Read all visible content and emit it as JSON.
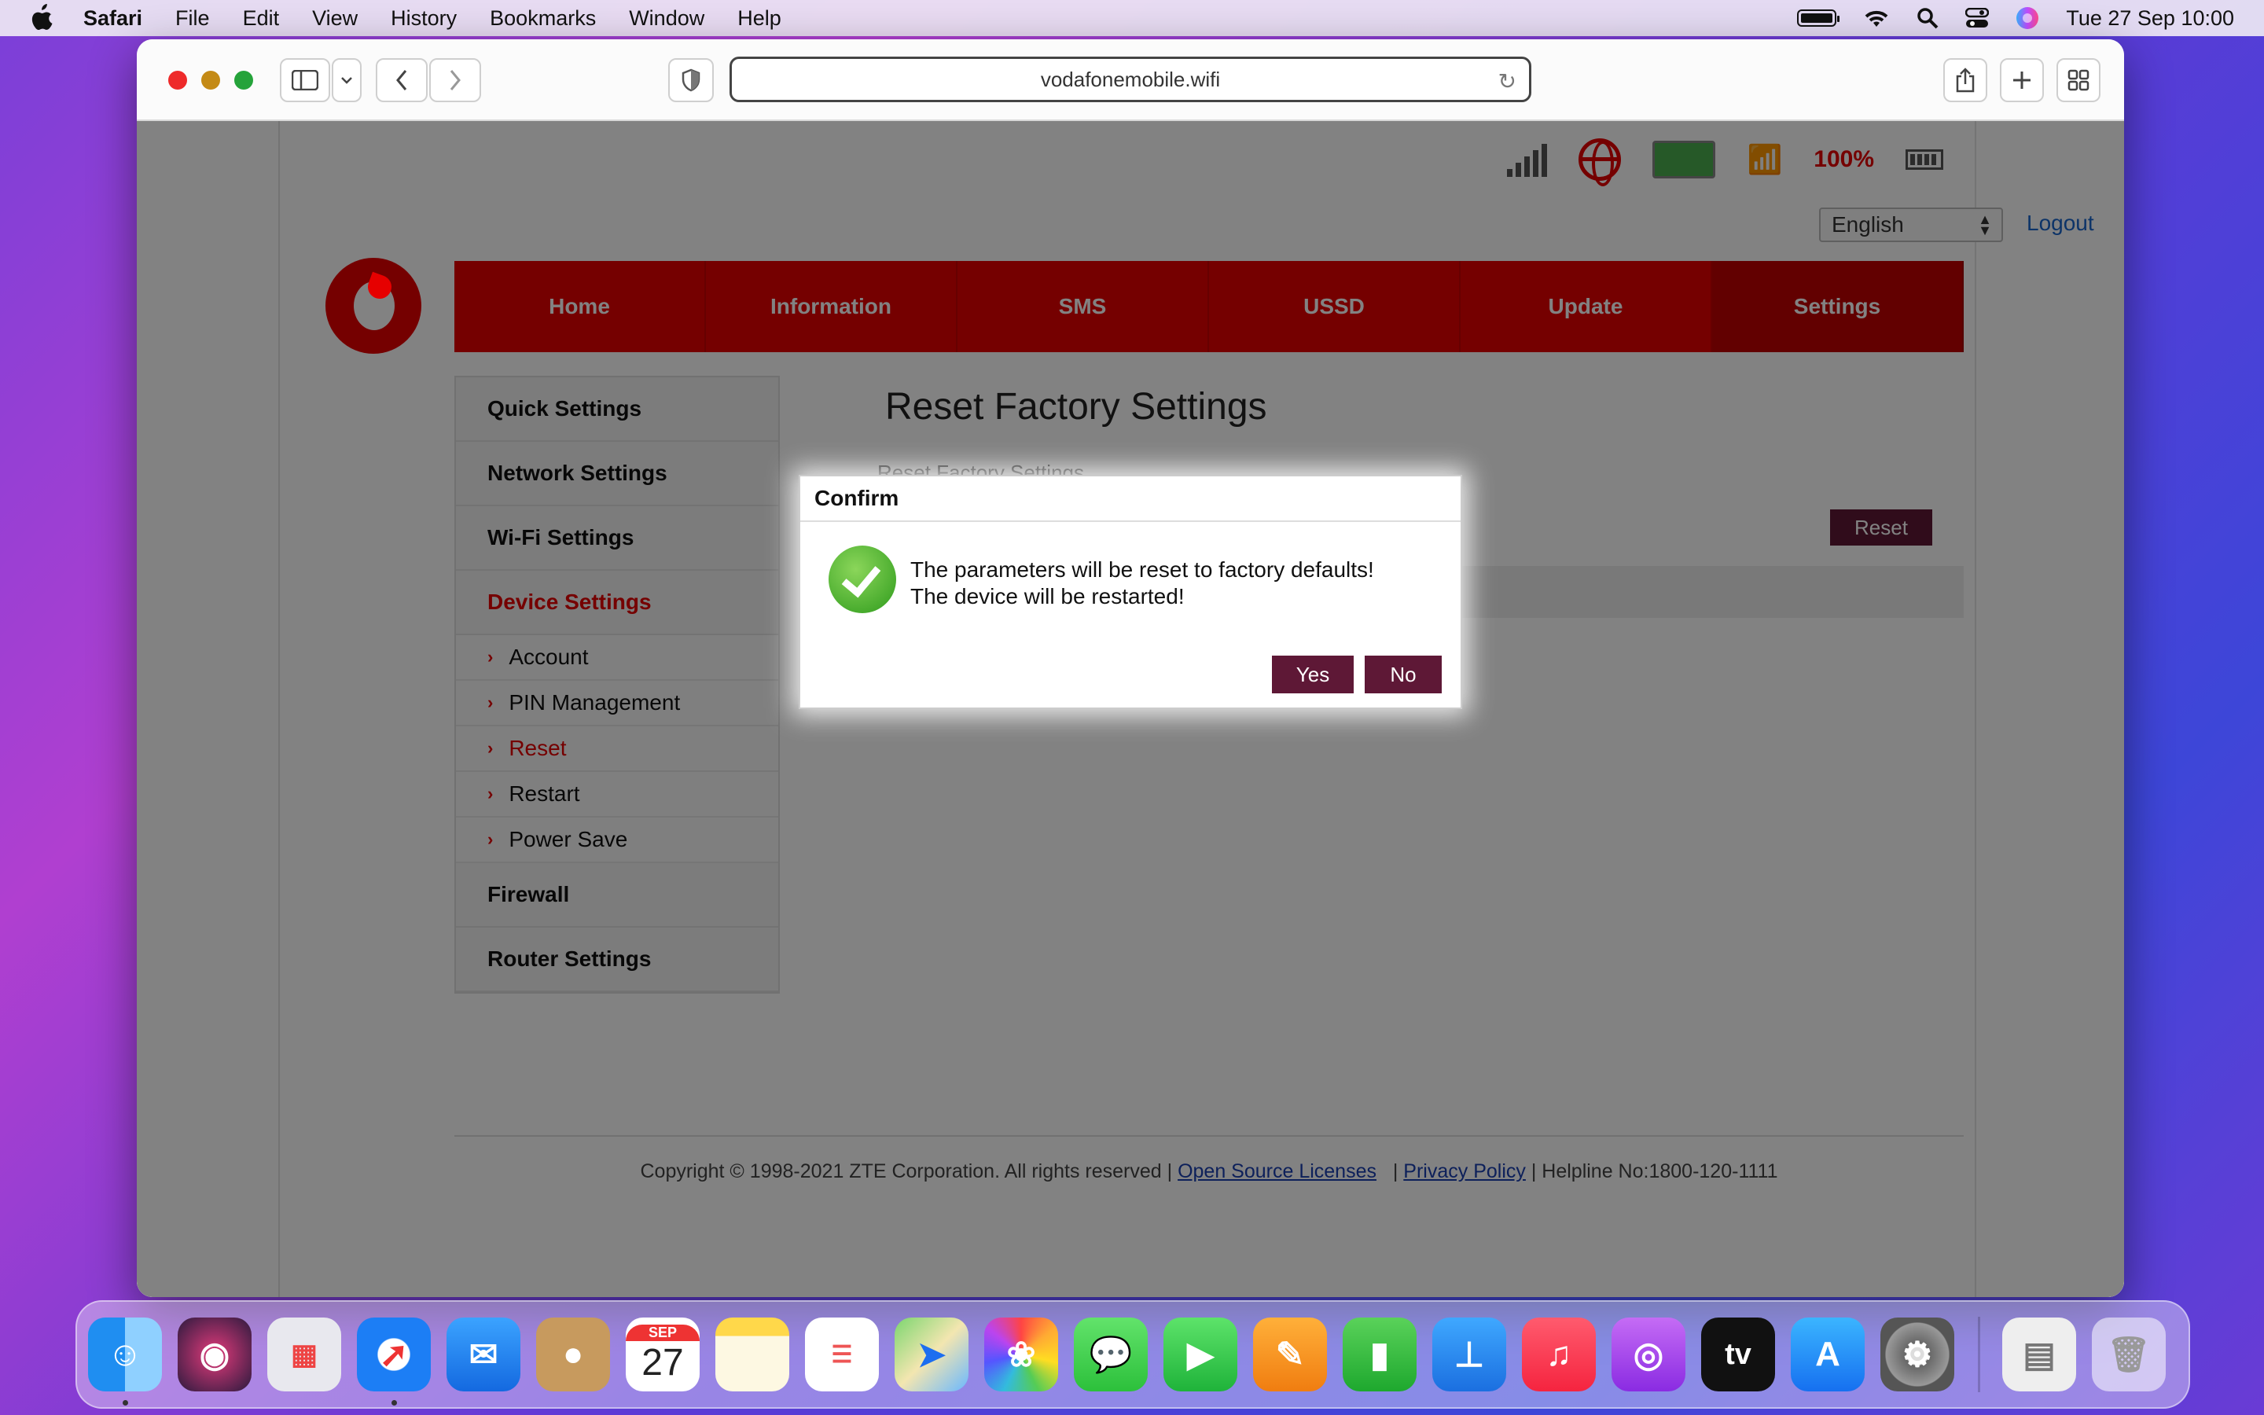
{
  "menubar": {
    "app_name": "Safari",
    "menus": [
      "File",
      "Edit",
      "View",
      "History",
      "Bookmarks",
      "Window",
      "Help"
    ],
    "clock": "Tue 27 Sep  10:00"
  },
  "browser": {
    "url": "vodafonemobile.wifi"
  },
  "router": {
    "battery_pct": "100%",
    "language": "English",
    "logout": "Logout",
    "nav": [
      "Home",
      "Information",
      "SMS",
      "USSD",
      "Update",
      "Settings"
    ],
    "active_nav": "Settings",
    "sidebar": {
      "quick": "Quick Settings",
      "network": "Network Settings",
      "wifi": "Wi-Fi Settings",
      "device": "Device Settings",
      "subs": [
        "Account",
        "PIN Management",
        "Reset",
        "Restart",
        "Power Save"
      ],
      "firewall": "Firewall",
      "router": "Router Settings"
    },
    "page_title": "Reset Factory Settings",
    "page_subtitle": "Reset Factory Settings",
    "reset_button": "Reset",
    "footer": {
      "copyright": "Copyright © 1998-2021 ZTE Corporation. All rights reserved  |",
      "oss": "Open Source Licenses",
      "sep": "|",
      "privacy": "Privacy Policy",
      "helpline": "|  Helpline No:1800-120-1111"
    }
  },
  "dialog": {
    "title": "Confirm",
    "line1": "The parameters will be reset to factory defaults!",
    "line2": "The device will be restarted!",
    "yes": "Yes",
    "no": "No"
  },
  "dock": {
    "calendar_month": "SEP",
    "calendar_day": "27",
    "tv_label": "tv"
  },
  "colors": {
    "vodafone_red": "#e60000",
    "dialog_button": "#5e1836"
  }
}
